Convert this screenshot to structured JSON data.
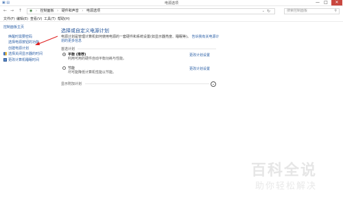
{
  "window": {
    "title": "电源选项",
    "minimize": "—",
    "maximize": "□",
    "close": "✕"
  },
  "nav": {
    "back": "←",
    "forward": "→",
    "up": "↑"
  },
  "address": {
    "crumbs": [
      "控制面板",
      "硬件和声音",
      "电源选项"
    ],
    "dropdown": "⌄",
    "refresh": "↻"
  },
  "search": {
    "placeholder": "搜索控制面板"
  },
  "menu": {
    "items": [
      "文件(F)",
      "编辑(E)",
      "查看(V)",
      "工具(T)",
      "帮助(H)"
    ]
  },
  "sidebar": {
    "items": [
      {
        "label": "控制面板主页"
      },
      {
        "label": "唤醒时需要密码"
      },
      {
        "label": "选择电源按钮的功能"
      },
      {
        "label": "创建电源计划"
      },
      {
        "label": "选择关闭显示器的时间"
      },
      {
        "label": "更改计算机睡眠时间"
      }
    ]
  },
  "main": {
    "heading": "选择或自定义电源计划",
    "description": "电源计划是管理计算机如何使用电源的一套硬件和系统设置(如显示器亮度、睡眠等)。",
    "description_link": "告诉我有关电源计划的更多信息",
    "section_label": "首选计划",
    "plans": [
      {
        "name": "平衡 (推荐)",
        "desc": "利用可用的硬件自动平衡功耗与性能。",
        "link": "更改计划设置",
        "selected": true
      },
      {
        "name": "节能",
        "desc": "尽可能降低计算机性能以节能。",
        "link": "更改计划设置",
        "selected": false
      }
    ],
    "extra_label": "显示附加计划",
    "expand_icon": "⌄"
  },
  "watermark": {
    "big": "百科全说",
    "small": "助你轻松解决"
  }
}
